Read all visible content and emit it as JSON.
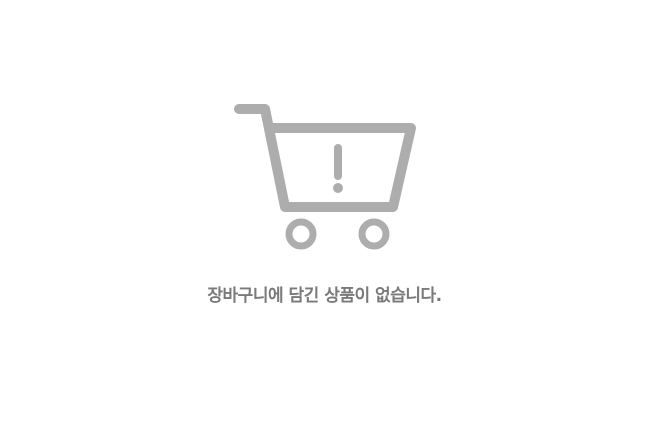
{
  "empty_state": {
    "icon": "cart-alert-icon",
    "message": "장바구니에 담긴 상품이 없습니다.",
    "icon_color": "#adadad",
    "text_color": "#7a7a7a"
  }
}
